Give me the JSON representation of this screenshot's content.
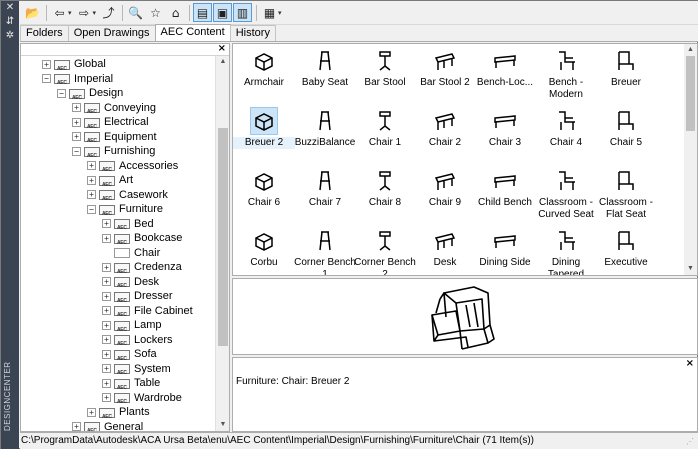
{
  "window": {
    "vertical_title": "DESIGNCENTER"
  },
  "toolbar": {
    "buttons": [
      {
        "name": "load-icon",
        "glyph": "📂"
      },
      {
        "name": "back-icon",
        "glyph": "⇦"
      },
      {
        "name": "back-dropdown-icon",
        "glyph": "▾"
      },
      {
        "name": "forward-icon",
        "glyph": "⇨"
      },
      {
        "name": "forward-dropdown-icon",
        "glyph": "▾"
      },
      {
        "name": "up-icon",
        "glyph": "⤴"
      },
      {
        "name": "search-icon",
        "glyph": "🔍"
      },
      {
        "name": "favorites-icon",
        "glyph": "☆"
      },
      {
        "name": "home-icon",
        "glyph": "⌂"
      },
      {
        "name": "tree-view-toggle-icon",
        "glyph": "▤"
      },
      {
        "name": "preview-toggle-icon",
        "glyph": "▣"
      },
      {
        "name": "description-toggle-icon",
        "glyph": "▥"
      },
      {
        "name": "views-icon",
        "glyph": "▦"
      },
      {
        "name": "views-dropdown-icon",
        "glyph": "▾"
      }
    ]
  },
  "tabs": [
    {
      "label": "Folders",
      "active": false
    },
    {
      "label": "Open Drawings",
      "active": false
    },
    {
      "label": "AEC Content",
      "active": true
    },
    {
      "label": "History",
      "active": false
    }
  ],
  "tree": {
    "close_glyph": "×",
    "nodes": [
      {
        "label": "Global",
        "depth": 1,
        "expander": "+"
      },
      {
        "label": "Imperial",
        "depth": 1,
        "expander": "−"
      },
      {
        "label": "Design",
        "depth": 2,
        "expander": "−"
      },
      {
        "label": "Conveying",
        "depth": 3,
        "expander": "+"
      },
      {
        "label": "Electrical",
        "depth": 3,
        "expander": "+"
      },
      {
        "label": "Equipment",
        "depth": 3,
        "expander": "+"
      },
      {
        "label": "Furnishing",
        "depth": 3,
        "expander": "−"
      },
      {
        "label": "Accessories",
        "depth": 4,
        "expander": "+"
      },
      {
        "label": "Art",
        "depth": 4,
        "expander": "+"
      },
      {
        "label": "Casework",
        "depth": 4,
        "expander": "+"
      },
      {
        "label": "Furniture",
        "depth": 4,
        "expander": "−"
      },
      {
        "label": "Bed",
        "depth": 5,
        "expander": "+"
      },
      {
        "label": "Bookcase",
        "depth": 5,
        "expander": "+"
      },
      {
        "label": "Chair",
        "depth": 5,
        "expander": "",
        "plain": true
      },
      {
        "label": "Credenza",
        "depth": 5,
        "expander": "+"
      },
      {
        "label": "Desk",
        "depth": 5,
        "expander": "+"
      },
      {
        "label": "Dresser",
        "depth": 5,
        "expander": "+"
      },
      {
        "label": "File Cabinet",
        "depth": 5,
        "expander": "+"
      },
      {
        "label": "Lamp",
        "depth": 5,
        "expander": "+"
      },
      {
        "label": "Lockers",
        "depth": 5,
        "expander": "+"
      },
      {
        "label": "Sofa",
        "depth": 5,
        "expander": "+"
      },
      {
        "label": "System",
        "depth": 5,
        "expander": "+"
      },
      {
        "label": "Table",
        "depth": 5,
        "expander": "+"
      },
      {
        "label": "Wardrobe",
        "depth": 5,
        "expander": "+"
      },
      {
        "label": "Plants",
        "depth": 4,
        "expander": "+"
      },
      {
        "label": "General",
        "depth": 3,
        "expander": "+"
      }
    ],
    "folder_badge": "AEC"
  },
  "items": [
    {
      "label": "Armchair",
      "icon": "armchair-icon"
    },
    {
      "label": "Baby Seat",
      "icon": "baby-seat-icon"
    },
    {
      "label": "Bar Stool",
      "icon": "bar-stool-icon"
    },
    {
      "label": "Bar Stool 2",
      "icon": "bar-stool-2-icon"
    },
    {
      "label": "Bench-Loc...",
      "icon": "bench-locker-icon"
    },
    {
      "label": "Bench - Modern",
      "icon": "bench-modern-icon"
    },
    {
      "label": "Breuer",
      "icon": "breuer-icon"
    },
    {
      "label": "Breuer 2",
      "icon": "breuer-2-icon",
      "selected": true
    },
    {
      "label": "BuzziBalance",
      "icon": "buzzibalance-icon"
    },
    {
      "label": "Chair 1",
      "icon": "chair-1-icon"
    },
    {
      "label": "Chair 2",
      "icon": "chair-2-icon"
    },
    {
      "label": "Chair 3",
      "icon": "chair-3-icon"
    },
    {
      "label": "Chair 4",
      "icon": "chair-4-icon"
    },
    {
      "label": "Chair 5",
      "icon": "chair-5-icon"
    },
    {
      "label": "Chair 6",
      "icon": "chair-6-icon"
    },
    {
      "label": "Chair 7",
      "icon": "chair-7-icon"
    },
    {
      "label": "Chair 8",
      "icon": "chair-8-icon"
    },
    {
      "label": "Chair 9",
      "icon": "chair-9-icon"
    },
    {
      "label": "Child Bench",
      "icon": "child-bench-icon"
    },
    {
      "label": "Classroom - Curved Seat",
      "icon": "classroom-curved-seat-icon"
    },
    {
      "label": "Classroom - Flat Seat",
      "icon": "classroom-flat-seat-icon"
    },
    {
      "label": "Corbu",
      "icon": "corbu-icon"
    },
    {
      "label": "Corner Bench 1",
      "icon": "corner-bench-1-icon"
    },
    {
      "label": "Corner Bench 2",
      "icon": "corner-bench-2-icon"
    },
    {
      "label": "Desk",
      "icon": "desk-chair-icon"
    },
    {
      "label": "Dining Side",
      "icon": "dining-side-icon"
    },
    {
      "label": "Dining Tapered",
      "icon": "dining-tapered-icon"
    },
    {
      "label": "Executive",
      "icon": "executive-icon"
    }
  ],
  "description": {
    "text": "Furniture: Chair: Breuer 2",
    "close_glyph": "×"
  },
  "status": {
    "path": "C:\\ProgramData\\Autodesk\\ACA Ursa Beta\\enu\\AEC Content\\Imperial\\Design\\Furnishing\\Furniture\\Chair (71 Item(s))"
  },
  "colors": {
    "selection": "#cce4f7",
    "sidebar": "#3b4453"
  }
}
